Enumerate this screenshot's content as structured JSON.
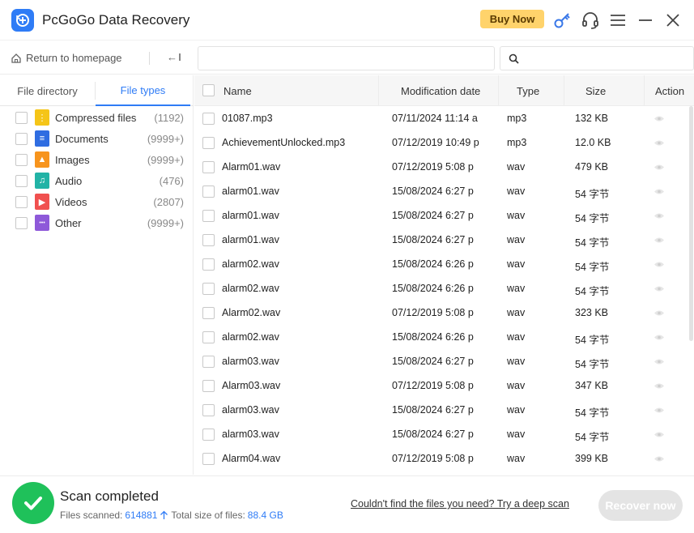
{
  "app": {
    "title": "PcGoGo Data Recovery",
    "buy_now": "Buy Now",
    "accent": "#2f7cf6"
  },
  "toolbar": {
    "home_label": "Return to homepage",
    "back_label": "←",
    "path_value": "",
    "search_value": ""
  },
  "tabs": [
    {
      "label": "File directory",
      "active": false
    },
    {
      "label": "File types",
      "active": true
    }
  ],
  "file_types": [
    {
      "label": "Compressed files",
      "count": "(1192)",
      "icon": "archive-icon",
      "color": "#f5c518"
    },
    {
      "label": "Documents",
      "count": "(9999+)",
      "icon": "document-icon",
      "color": "#2f6de1"
    },
    {
      "label": "Images",
      "count": "(9999+)",
      "icon": "image-icon",
      "color": "#f7941d"
    },
    {
      "label": "Audio",
      "count": "(476)",
      "icon": "audio-icon",
      "color": "#22b3a6"
    },
    {
      "label": "Videos",
      "count": "(2807)",
      "icon": "video-icon",
      "color": "#f0504f"
    },
    {
      "label": "Other",
      "count": "(9999+)",
      "icon": "other-icon",
      "color": "#8e59d9"
    }
  ],
  "table": {
    "columns": [
      "Name",
      "Modification date",
      "Type",
      "Size",
      "Action"
    ],
    "rows": [
      {
        "name": "01087.mp3",
        "date": "07/11/2024 11:14 a",
        "type": "mp3",
        "size": "132 KB"
      },
      {
        "name": "AchievementUnlocked.mp3",
        "date": "07/12/2019 10:49 p",
        "type": "mp3",
        "size": "12.0 KB"
      },
      {
        "name": "Alarm01.wav",
        "date": "07/12/2019 5:08 p",
        "type": "wav",
        "size": "479 KB"
      },
      {
        "name": "alarm01.wav",
        "date": "15/08/2024 6:27 p",
        "type": "wav",
        "size": "54 字节"
      },
      {
        "name": "alarm01.wav",
        "date": "15/08/2024 6:27 p",
        "type": "wav",
        "size": "54 字节"
      },
      {
        "name": "alarm01.wav",
        "date": "15/08/2024 6:27 p",
        "type": "wav",
        "size": "54 字节"
      },
      {
        "name": "alarm02.wav",
        "date": "15/08/2024 6:26 p",
        "type": "wav",
        "size": "54 字节"
      },
      {
        "name": "alarm02.wav",
        "date": "15/08/2024 6:26 p",
        "type": "wav",
        "size": "54 字节"
      },
      {
        "name": "Alarm02.wav",
        "date": "07/12/2019 5:08 p",
        "type": "wav",
        "size": "323 KB"
      },
      {
        "name": "alarm02.wav",
        "date": "15/08/2024 6:26 p",
        "type": "wav",
        "size": "54 字节"
      },
      {
        "name": "alarm03.wav",
        "date": "15/08/2024 6:27 p",
        "type": "wav",
        "size": "54 字节"
      },
      {
        "name": "Alarm03.wav",
        "date": "07/12/2019 5:08 p",
        "type": "wav",
        "size": "347 KB"
      },
      {
        "name": "alarm03.wav",
        "date": "15/08/2024 6:27 p",
        "type": "wav",
        "size": "54 字节"
      },
      {
        "name": "alarm03.wav",
        "date": "15/08/2024 6:27 p",
        "type": "wav",
        "size": "54 字节"
      },
      {
        "name": "Alarm04.wav",
        "date": "07/12/2019 5:08 p",
        "type": "wav",
        "size": "399 KB"
      }
    ]
  },
  "footer": {
    "status": "Scan completed",
    "files_scanned_label": "Files scanned:",
    "files_scanned_value": "614881",
    "total_size_label": "Total size of files:",
    "total_size_value": "88.4 GB",
    "deep_scan_link": "Couldn't find the files you need? Try a deep scan",
    "recover_button": "Recover now"
  }
}
